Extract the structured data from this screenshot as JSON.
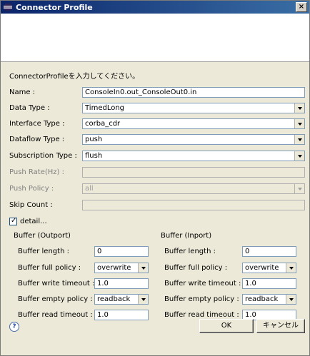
{
  "window": {
    "title": "Connector Profile",
    "close_glyph": "×"
  },
  "description": "ConnectorProfileを入力してください。",
  "fields": {
    "name": {
      "label": "Name :",
      "value": "ConsoleIn0.out_ConsoleOut0.in"
    },
    "data_type": {
      "label": "Data Type :",
      "value": "TimedLong"
    },
    "interface_type": {
      "label": "Interface Type :",
      "value": "corba_cdr"
    },
    "dataflow_type": {
      "label": "Dataflow Type :",
      "value": "push"
    },
    "subscription_type": {
      "label": "Subscription Type :",
      "value": "flush"
    },
    "push_rate": {
      "label": "Push Rate(Hz) :",
      "value": ""
    },
    "push_policy": {
      "label": "Push Policy :",
      "value": "all"
    },
    "skip_count": {
      "label": "Skip Count :",
      "value": ""
    }
  },
  "detail": {
    "label": "detail...",
    "checked": true,
    "check_glyph": "✓"
  },
  "outport": {
    "title": "Buffer (Outport)",
    "buffer_length": {
      "label": "Buffer length :",
      "value": "0"
    },
    "full_policy": {
      "label": "Buffer full policy :",
      "value": "overwrite"
    },
    "write_timeout": {
      "label": "Buffer write timeout :",
      "value": "1.0"
    },
    "empty_policy": {
      "label": "Buffer empty policy :",
      "value": "readback"
    },
    "read_timeout": {
      "label": "Buffer read timeout :",
      "value": "1.0"
    }
  },
  "inport": {
    "title": "Buffer (Inport)",
    "buffer_length": {
      "label": "Buffer length :",
      "value": "0"
    },
    "full_policy": {
      "label": "Buffer full policy :",
      "value": "overwrite"
    },
    "write_timeout": {
      "label": "Buffer write timeout :",
      "value": "1.0"
    },
    "empty_policy": {
      "label": "Buffer empty policy :",
      "value": "readback"
    },
    "read_timeout": {
      "label": "Buffer read timeout :",
      "value": "1.0"
    }
  },
  "buttons": {
    "help": "?",
    "ok": "OK",
    "cancel": "キャンセル"
  },
  "icons": {
    "title": "eclipse-icon",
    "help": "help-icon"
  }
}
